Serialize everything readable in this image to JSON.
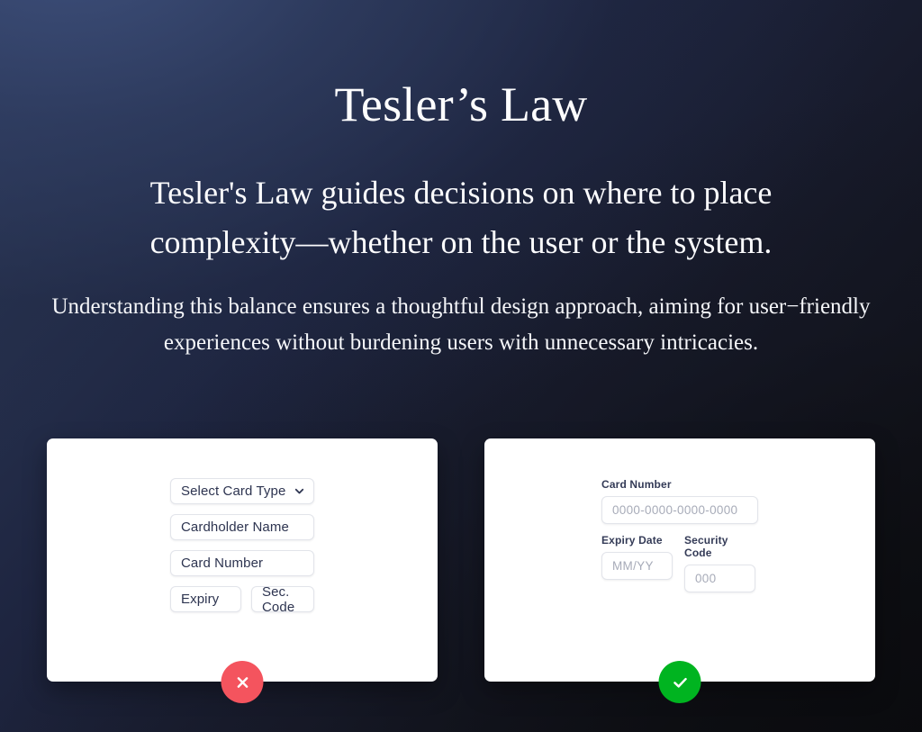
{
  "hero": {
    "title": "Tesler’s Law",
    "subtitle": "Tesler's Law guides decisions on where to place complexity—whether on the user or the system.",
    "body": "Understanding this balance ensures a thoughtful design approach, aiming for user−friendly experiences without burdening users with unnecessary intricacies."
  },
  "colors": {
    "background_top_left": "#2f3c5e",
    "background_bottom_right": "#0f0f13",
    "card_background": "#ffffff",
    "field_border": "#e2e4ea",
    "field_text": "#2d3450",
    "label_text": "#343b57",
    "placeholder_text": "#a7abb8",
    "badge_error": "#f4545e",
    "badge_success": "#00b420"
  },
  "cards": {
    "complex": {
      "fields": [
        {
          "name": "card-type-select",
          "value": "Select Card Type",
          "icon": "chevron-down-icon"
        },
        {
          "name": "cardholder-name-input",
          "value": "Cardholder Name"
        },
        {
          "name": "card-number-input",
          "value": "Card Number"
        },
        {
          "name": "expiry-input",
          "value": "Expiry"
        },
        {
          "name": "security-code-input",
          "value": "Sec. Code"
        }
      ],
      "badge": {
        "icon": "close-icon",
        "color": "#f4545e"
      }
    },
    "simple": {
      "groups": [
        {
          "label": "Card Number",
          "placeholder": "0000-0000-0000-0000"
        },
        {
          "label": "Expiry Date",
          "placeholder": "MM/YY"
        },
        {
          "label": "Security Code",
          "placeholder": "000"
        }
      ],
      "badge": {
        "icon": "check-icon",
        "color": "#00b420"
      }
    }
  }
}
